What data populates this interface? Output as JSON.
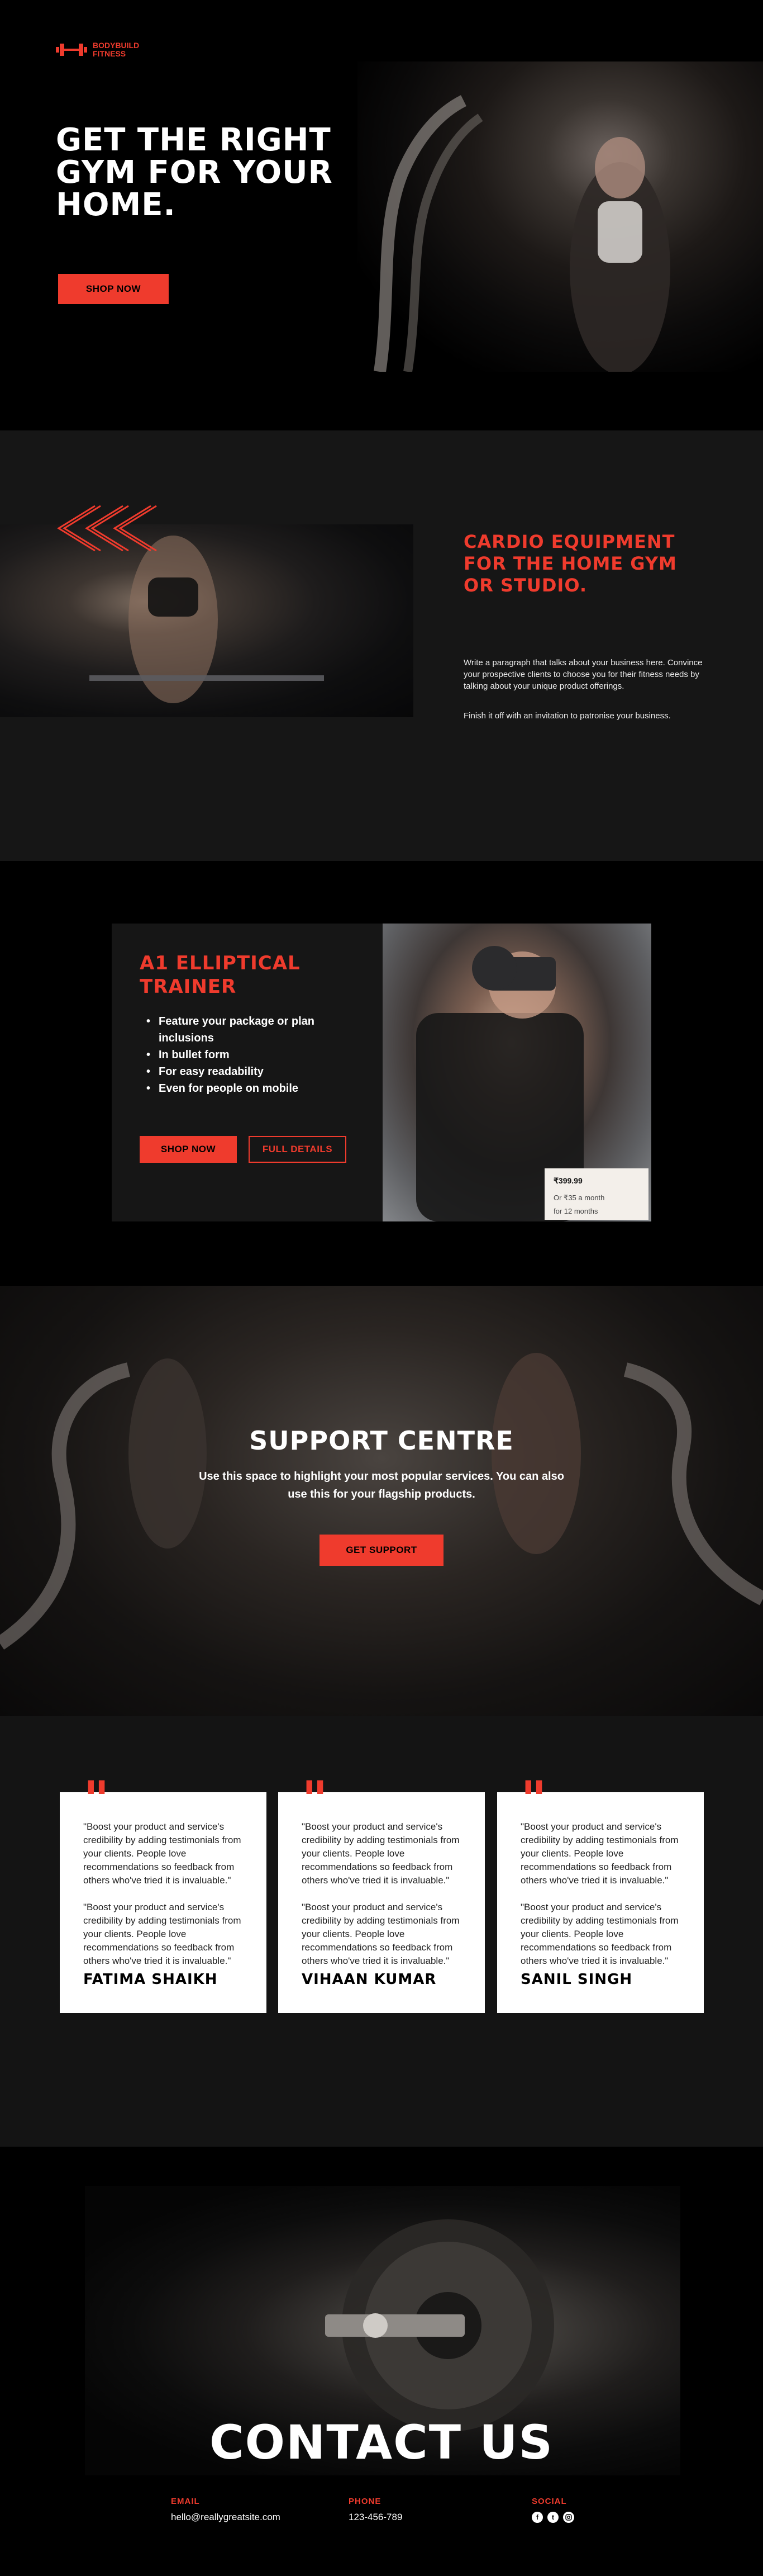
{
  "brand": {
    "logo_icon": "dumbbell-icon",
    "name_line1": "BODYBUILD",
    "name_line2": "FITNESS",
    "accent": "#ef3b2d"
  },
  "hero": {
    "title": "GET THE RIGHT GYM FOR YOUR HOME.",
    "shop_button": "SHOP NOW",
    "image_desc": "woman-with-battle-ropes"
  },
  "cardio": {
    "title": "CARDIO EQUIPMENT FOR THE HOME GYM OR STUDIO.",
    "paragraph1": "Write a paragraph that talks about your business here. Convince your prospective clients to choose you for their fitness needs by talking about your unique product offerings.",
    "paragraph2": "Finish it off with an invitation to patronise your business."
  },
  "product": {
    "title": "A1 ELLIPTICAL TRAINER",
    "bullets": [
      "Feature your package or plan inclusions",
      "In bullet form",
      "For easy readability",
      "Even for people on mobile"
    ],
    "shop_button": "SHOP NOW",
    "details_button": "FULL DETAILS",
    "price": "₹399.99",
    "price_monthly": "Or ₹35 a month",
    "price_term": "for 12 months"
  },
  "support": {
    "title": "SUPPORT CENTRE",
    "description": "Use this space to highlight your most popular services. You can also use this for your flagship products.",
    "button": "GET SUPPORT"
  },
  "testimonials": [
    {
      "quote1": "\"Boost your product and service's credibility by adding testimonials from your clients. People love recommendations so feedback from others who've tried it is invaluable.\"",
      "quote2": "\"Boost your product and service's credibility by adding testimonials from your clients. People love recommendations so feedback from others who've tried it is invaluable.\"",
      "name": "FATIMA SHAIKH"
    },
    {
      "quote1": "\"Boost your product and service's credibility by adding testimonials from your clients. People love recommendations so feedback from others who've tried it is invaluable.\"",
      "quote2": "\"Boost your product and service's credibility by adding testimonials from your clients. People love recommendations so feedback from others who've tried it is invaluable.\"",
      "name": "VIHAAN KUMAR"
    },
    {
      "quote1": "\"Boost your product and service's credibility by adding testimonials from your clients. People love recommendations so feedback from others who've tried it is invaluable.\"",
      "quote2": "\"Boost your product and service's credibility by adding testimonials from your clients. People love recommendations so feedback from others who've tried it is invaluable.\"",
      "name": "SANIL SINGH"
    }
  ],
  "contact": {
    "title": "CONTACT US",
    "email_label": "EMAIL",
    "email": "hello@reallygreatsite.com",
    "phone_label": "PHONE",
    "phone": "123-456-789",
    "social_label": "SOCIAL",
    "social_icons": [
      "facebook-icon",
      "twitter-icon",
      "instagram-icon"
    ]
  }
}
